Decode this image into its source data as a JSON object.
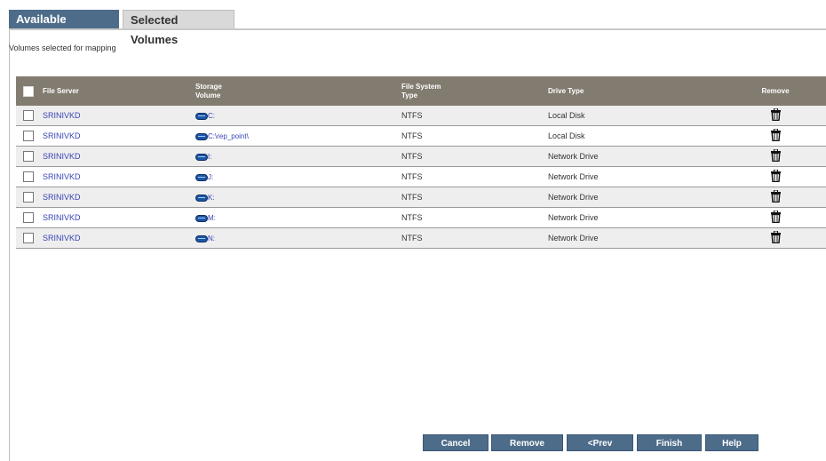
{
  "tabs": {
    "available": "Available Volumes",
    "selected": "Selected Volumes"
  },
  "subtitle": "Volumes selected for mapping",
  "table": {
    "headers": {
      "file_server": "File Server",
      "storage_volume_1": "Storage",
      "storage_volume_2": "Volume",
      "filesystem_type_1": "File System",
      "filesystem_type_2": "Type",
      "drive_type": "Drive Type",
      "remove": "Remove"
    },
    "rows": [
      {
        "server": "SRINIVKD",
        "volume": "C:",
        "fs": "NTFS",
        "drive": "Local Disk"
      },
      {
        "server": "SRINIVKD",
        "volume": "C:\\rep_point\\",
        "fs": "NTFS",
        "drive": "Local Disk"
      },
      {
        "server": "SRINIVKD",
        "volume": "I:",
        "fs": "NTFS",
        "drive": "Network Drive"
      },
      {
        "server": "SRINIVKD",
        "volume": "J:",
        "fs": "NTFS",
        "drive": "Network Drive"
      },
      {
        "server": "SRINIVKD",
        "volume": "K:",
        "fs": "NTFS",
        "drive": "Network Drive"
      },
      {
        "server": "SRINIVKD",
        "volume": "M:",
        "fs": "NTFS",
        "drive": "Network Drive"
      },
      {
        "server": "SRINIVKD",
        "volume": "N:",
        "fs": "NTFS",
        "drive": "Network Drive"
      }
    ]
  },
  "buttons": {
    "cancel": "Cancel",
    "remove": "Remove",
    "prev": "<Prev",
    "finish": "Finish",
    "help": "Help"
  },
  "icons": {
    "volume": "disk-drive-icon",
    "remove": "trash-icon"
  },
  "colors": {
    "tab_active": "#4d6c8a",
    "header_bg": "#827b70",
    "link": "#3744b4",
    "button": "#4d6c8a"
  }
}
